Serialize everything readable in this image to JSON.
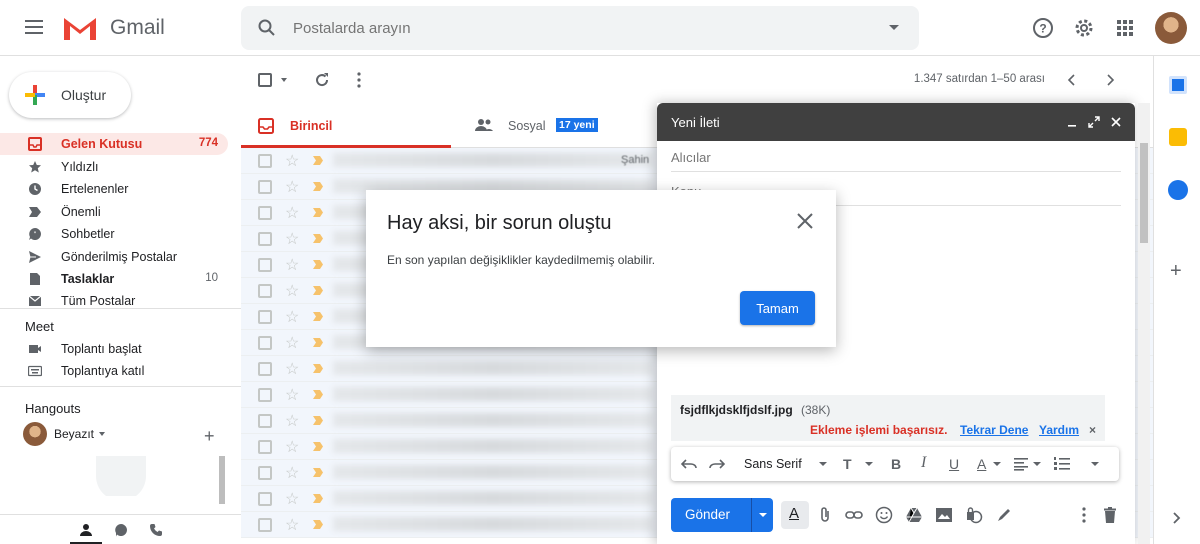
{
  "header": {
    "app_name": "Gmail",
    "search_placeholder": "Postalarda arayın"
  },
  "compose_button": {
    "label": "Oluştur"
  },
  "sidebar": {
    "items": [
      {
        "label": "Gelen Kutusu",
        "count": "774",
        "icon": "inbox-icon"
      },
      {
        "label": "Yıldızlı",
        "count": "",
        "icon": "star-icon"
      },
      {
        "label": "Ertelenenler",
        "count": "",
        "icon": "clock-icon"
      },
      {
        "label": "Önemli",
        "count": "",
        "icon": "important-icon"
      },
      {
        "label": "Sohbetler",
        "count": "",
        "icon": "chat-icon"
      },
      {
        "label": "Gönderilmiş Postalar",
        "count": "",
        "icon": "send-icon"
      },
      {
        "label": "Taslaklar",
        "count": "10",
        "icon": "draft-icon"
      },
      {
        "label": "Tüm Postalar",
        "count": "",
        "icon": "mail-icon"
      }
    ],
    "meet": {
      "title": "Meet",
      "items": [
        {
          "label": "Toplantı başlat",
          "icon": "video-icon"
        },
        {
          "label": "Toplantıya katıl",
          "icon": "keyboard-icon"
        }
      ]
    },
    "hangouts": {
      "title": "Hangouts",
      "user": "Beyazıt"
    }
  },
  "toolbar": {
    "range": "1.347 satırdan 1–50 arası"
  },
  "tabs": [
    {
      "label": "Birincil",
      "badge": ""
    },
    {
      "label": "Sosyal",
      "badge": "17 yeni"
    }
  ],
  "rows": [
    {
      "fragment": "Şahin"
    },
    {
      "fragment": ""
    },
    {
      "fragment": ""
    },
    {
      "fragment": ""
    },
    {
      "fragment": ""
    },
    {
      "fragment": ""
    },
    {
      "fragment": ""
    },
    {
      "fragment": ""
    },
    {
      "fragment": ""
    },
    {
      "fragment": ""
    },
    {
      "fragment": ""
    },
    {
      "fragment": ""
    },
    {
      "fragment": ""
    },
    {
      "fragment": ""
    },
    {
      "fragment": ""
    }
  ],
  "error_dialog": {
    "title": "Hay aksi, bir sorun oluştu",
    "message": "En son yapılan değişiklikler kaydedilmemiş olabilir.",
    "ok_label": "Tamam"
  },
  "compose": {
    "title": "Yeni İleti",
    "to_placeholder": "Alıcılar",
    "subject_placeholder": "Konu",
    "attachment": {
      "name": "fsjdflkjdsklfjdslf.jpg",
      "size": "(38K)",
      "error": "Ekleme işlemi başarısız.",
      "retry": "Tekrar Dene",
      "help": "Yardım"
    },
    "font": "Sans Serif",
    "send_label": "Gönder"
  },
  "colors": {
    "accent": "#1a73e8",
    "gmail_red": "#d93025",
    "compose_header": "#404040"
  }
}
